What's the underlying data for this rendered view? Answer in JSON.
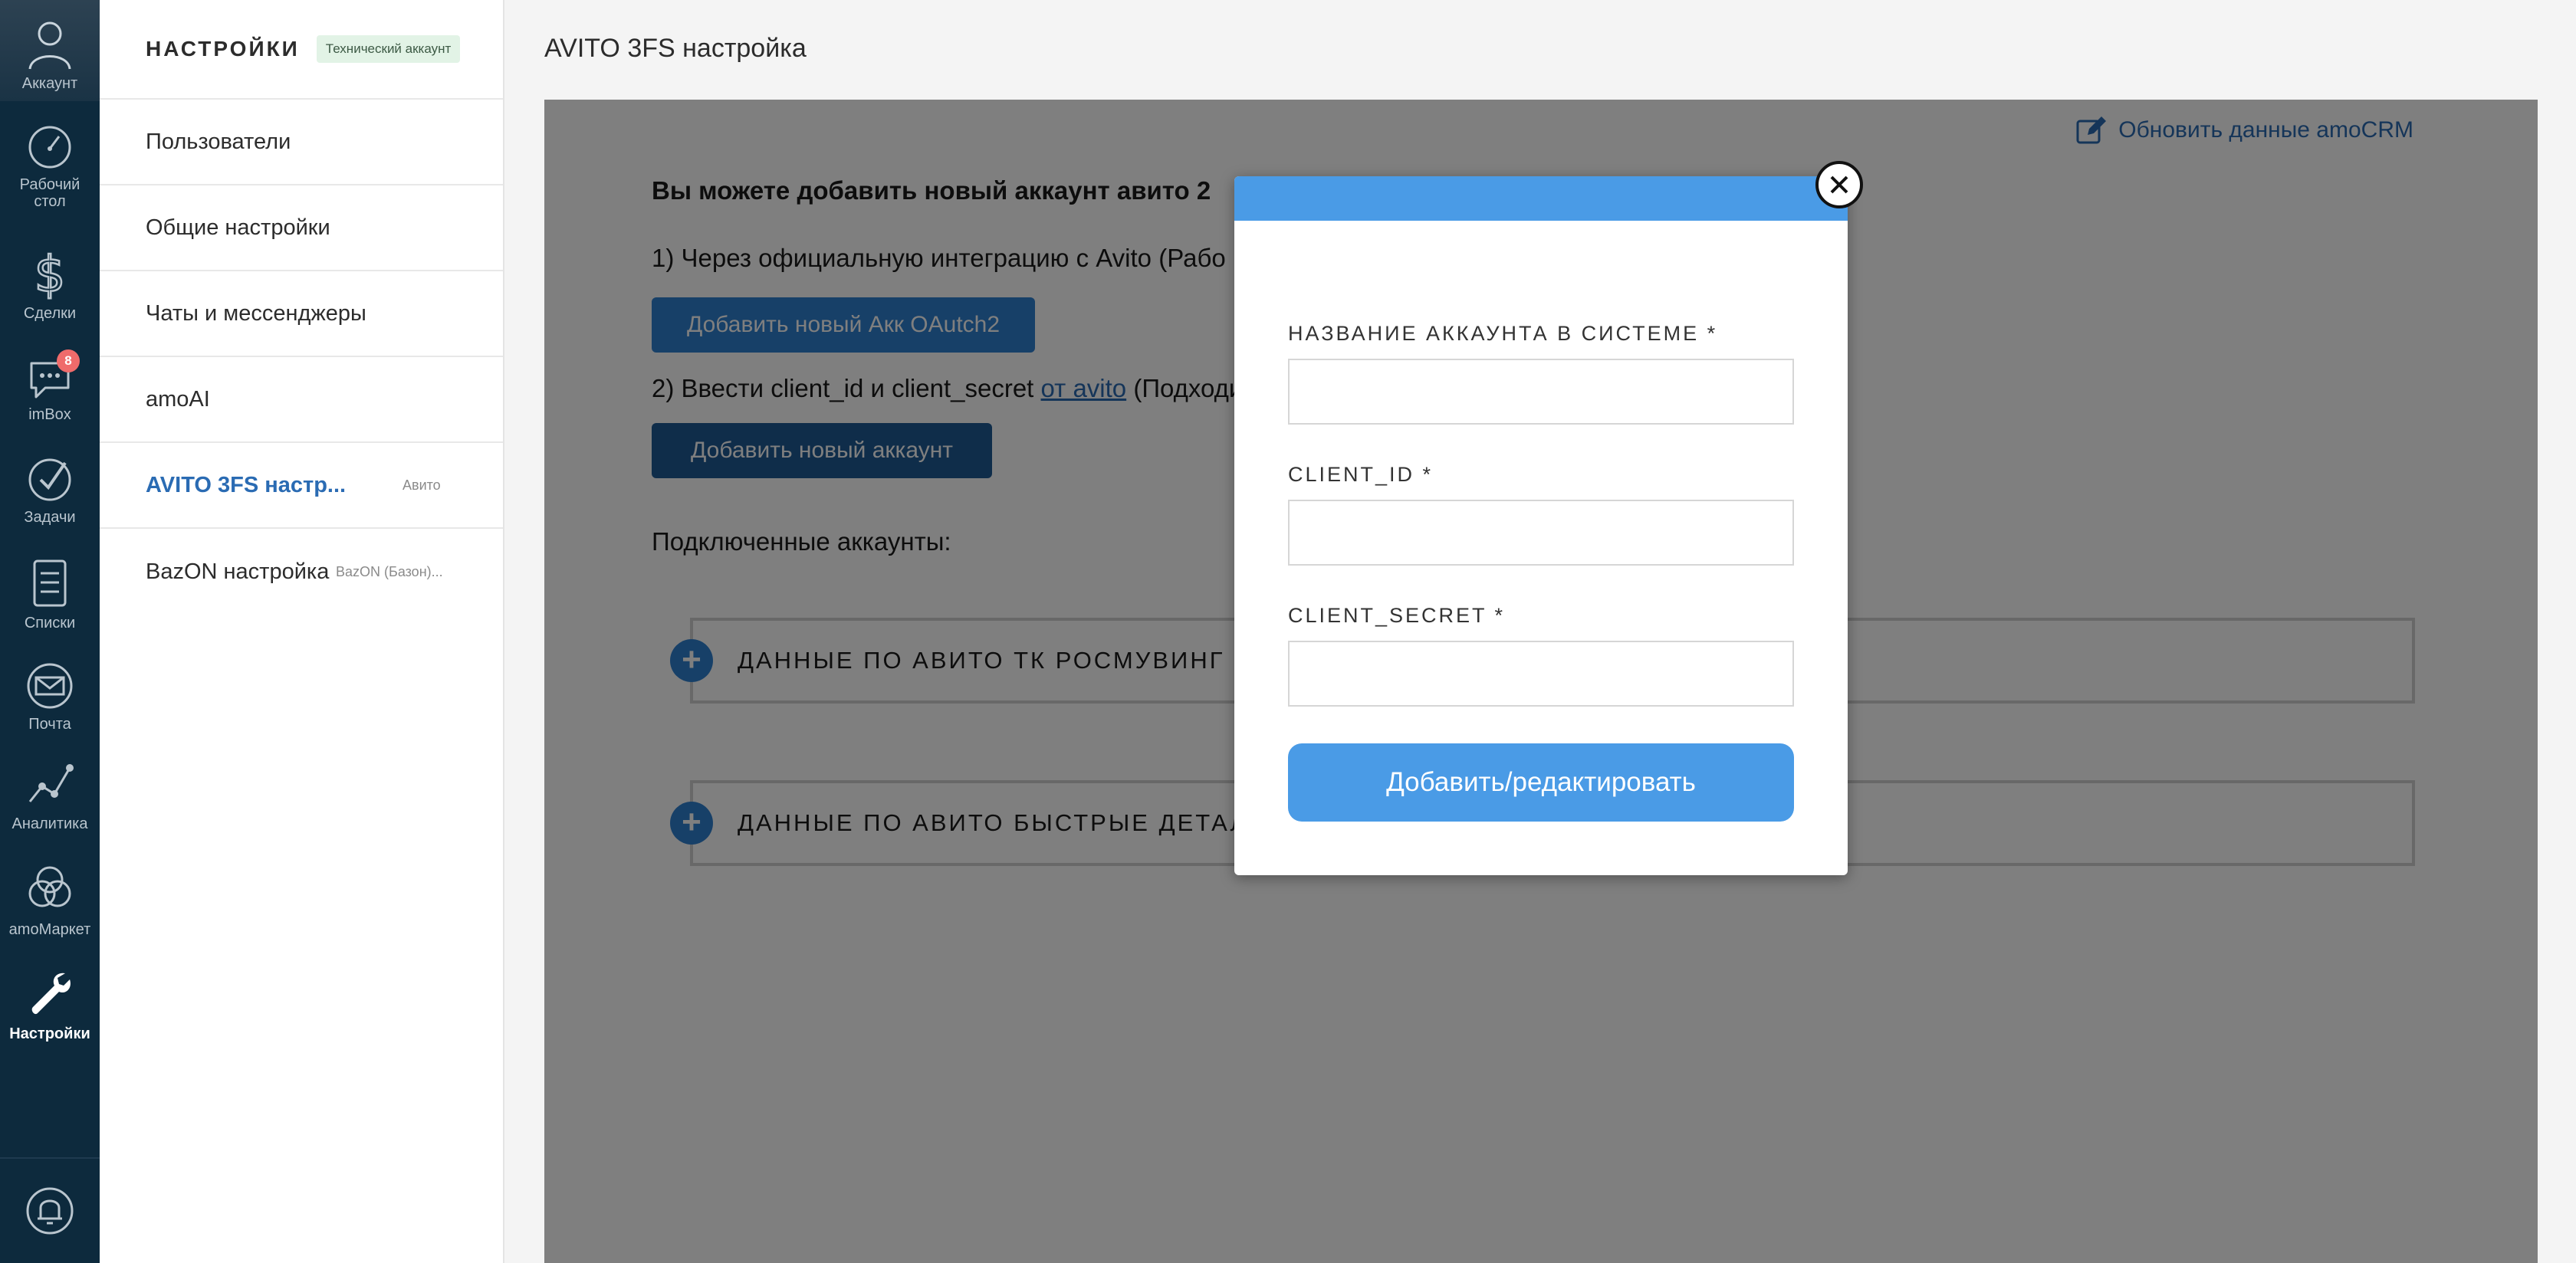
{
  "rail": {
    "account": "Аккаунт",
    "dashboard": "Рабочий стол",
    "deals": "Сделки",
    "imbox": "imBox",
    "imbox_badge": "8",
    "tasks": "Задачи",
    "lists": "Списки",
    "mail": "Почта",
    "analytics": "Аналитика",
    "market": "amoМаркет",
    "settings": "Настройки"
  },
  "submenu": {
    "title": "НАСТРОЙКИ",
    "badge": "Технический аккаунт",
    "items": [
      {
        "label": "Пользователи",
        "tag": ""
      },
      {
        "label": "Общие настройки",
        "tag": ""
      },
      {
        "label": "Чаты и мессенджеры",
        "tag": ""
      },
      {
        "label": "amoAI",
        "tag": ""
      },
      {
        "label": "AVITO 3FS настр...",
        "tag": "Авито"
      },
      {
        "label": "BazON настройка",
        "tag": "BazON (Базон)..."
      }
    ]
  },
  "main": {
    "page_title": "AVITO 3FS настройка",
    "refresh_link": "Обновить данные amoCRM",
    "lead": "Вы можете добавить новый аккаунт авито 2",
    "option1": "1) Через официальную интеграцию с Avito (Рабо",
    "oauth_button": "Добавить новый Акк OAutch2",
    "option2_prefix": "2) Ввести client_id и client_secret ",
    "option2_link": "от avito",
    "option2_suffix": " (Подходи",
    "add_button": "Добавить новый аккаунт",
    "connected_label": "Подключенные аккаунты:",
    "accounts": [
      {
        "name": "ДАННЫЕ ПО АВИТО ТК РОСМУВИНГ"
      },
      {
        "name": "ДАННЫЕ ПО АВИТО БЫСТРЫЕ ДЕТАЛИ"
      }
    ]
  },
  "modal": {
    "name_label": "НАЗВАНИЕ АККАУНТА В СИСТЕМЕ *",
    "name_value": "",
    "client_id_label": "CLIENT_ID *",
    "client_id_value": "",
    "client_secret_label": "CLIENT_SECRET *",
    "client_secret_value": "",
    "submit_label": "Добавить/редактировать"
  },
  "colors": {
    "rail_bg": "#0d2a3d",
    "accent": "#2f80d1",
    "modal_accent": "#4a9be6",
    "link": "#2a6bb3",
    "badge": "#ef6b6b"
  }
}
